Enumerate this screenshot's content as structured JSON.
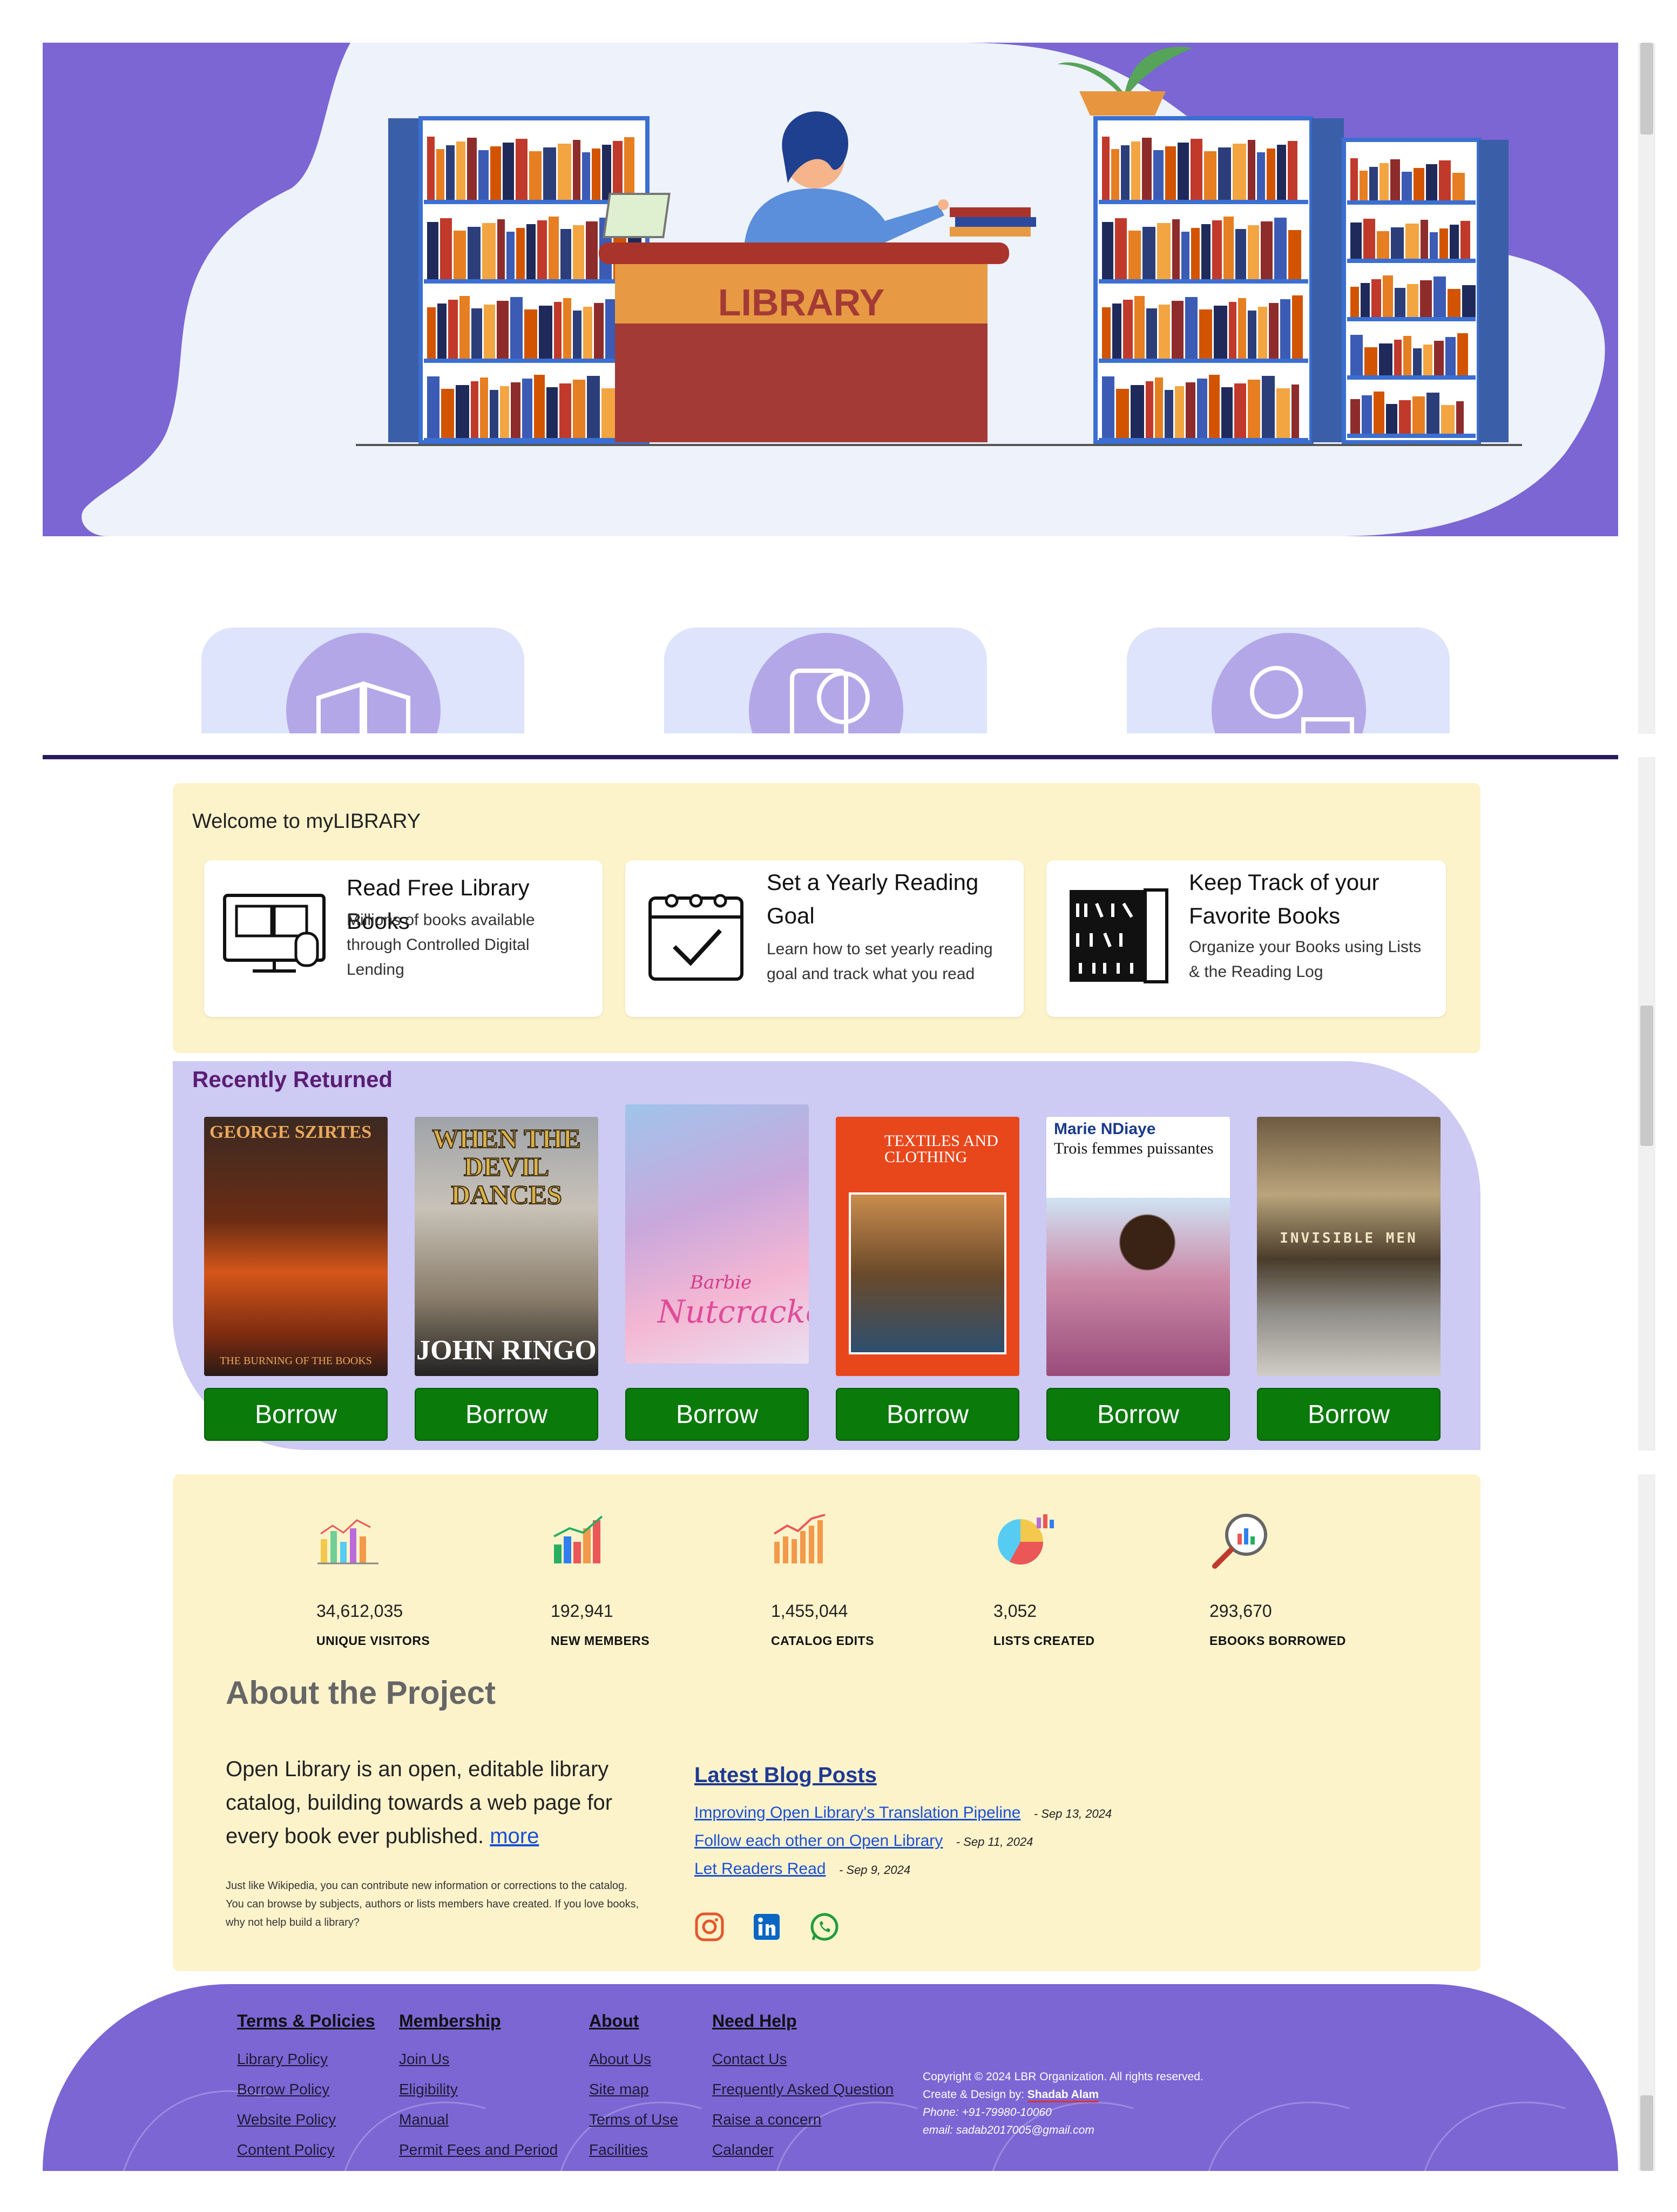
{
  "hero": {
    "sign_text": "LIBRARY"
  },
  "features": [
    {
      "icon": "open-book-icon"
    },
    {
      "icon": "reading-tablet-icon"
    },
    {
      "icon": "librarian-icon"
    }
  ],
  "welcome": {
    "heading": "Welcome to myLIBRARY",
    "cards": [
      {
        "icon": "computer-book-icon",
        "title": "Read Free Library Books",
        "desc": "Millions of books available through Controlled Digital Lending"
      },
      {
        "icon": "calendar-check-icon",
        "title": "Set a Yearly Reading Goal",
        "desc": "Learn how to set yearly reading goal and track what you read"
      },
      {
        "icon": "bookshelf-icon",
        "title": "Keep Track of your Favorite Books",
        "desc": "Organize your Books using Lists & the Reading Log"
      }
    ]
  },
  "recently_returned": {
    "heading": "Recently Returned",
    "books": [
      {
        "cover_title": "THE BURNING OF THE BOOKS",
        "author": "GEORGE SZIRTES",
        "button": "Borrow"
      },
      {
        "cover_title": "WHEN THE DEVIL DANCES",
        "author": "JOHN RINGO",
        "button": "Borrow"
      },
      {
        "cover_title": "Nutcracker",
        "author": "Barbie",
        "button": "Borrow"
      },
      {
        "cover_title": "TEXTILES AND CLOTHING",
        "author": "",
        "button": "Borrow"
      },
      {
        "cover_title": "Trois femmes puissantes",
        "author": "Marie NDiaye",
        "button": "Borrow"
      },
      {
        "cover_title": "INVISIBLE MEN",
        "author": "",
        "button": "Borrow"
      }
    ]
  },
  "stats": [
    {
      "icon": "bar-chart-icon",
      "value": "34,612,035",
      "label": "UNIQUE VISITORS"
    },
    {
      "icon": "growth-chart-icon",
      "value": "192,941",
      "label": "NEW MEMBERS"
    },
    {
      "icon": "trend-chart-icon",
      "value": "1,455,044",
      "label": "CATALOG EDITS"
    },
    {
      "icon": "pie-chart-icon",
      "value": "3,052",
      "label": "LISTS CREATED"
    },
    {
      "icon": "analytics-magnifier-icon",
      "value": "293,670",
      "label": "EBOOKS BORROWED"
    }
  ],
  "about": {
    "title": "About the Project",
    "lead": "Open Library is an open, editable library catalog, building towards a web page for every book ever published.",
    "more_link": "more",
    "small": "Just like Wikipedia, you can contribute new information or corrections to the catalog. You can browse by subjects, authors or lists members have created. If you love books, why not help build a library?"
  },
  "blog": {
    "title": "Latest Blog Posts",
    "posts": [
      {
        "title": "Improving Open Library's Translation Pipeline",
        "date": "- Sep 13, 2024"
      },
      {
        "title": "Follow each other on Open Library",
        "date": "- Sep 11, 2024"
      },
      {
        "title": "Let Readers Read",
        "date": "- Sep 9, 2024"
      }
    ],
    "social": [
      "instagram-icon",
      "linkedin-icon",
      "whatsapp-icon"
    ]
  },
  "footer": {
    "columns": [
      {
        "heading": "Terms & Policies",
        "items": [
          "Library Policy",
          "Borrow Policy",
          "Website Policy",
          "Content Policy"
        ]
      },
      {
        "heading": "Membership",
        "items": [
          "Join Us",
          "Eligibility",
          "Manual",
          "Permit Fees and Period"
        ]
      },
      {
        "heading": "About",
        "items": [
          "About Us",
          "Site map",
          "Terms of Use",
          "Facilities"
        ]
      },
      {
        "heading": "Need Help",
        "items": [
          "Contact Us",
          "Frequently Asked Question",
          "Raise a concern",
          "Calander"
        ]
      }
    ],
    "copyright": "Copyright © 2024 LBR Organization. All rights reserved.",
    "designed_by_label": "Create & Design by:",
    "designer": "Shadab Alam",
    "phone": "Phone: +91-79980-10060",
    "email": "email: sadab2017005@gmail.com"
  },
  "colors": {
    "accent_purple": "#7b66d4",
    "cream": "#fdf3cb",
    "lavender": "#cdcaf3",
    "borrow_green": "#0a7a0a",
    "link_blue": "#1a4fd6"
  }
}
